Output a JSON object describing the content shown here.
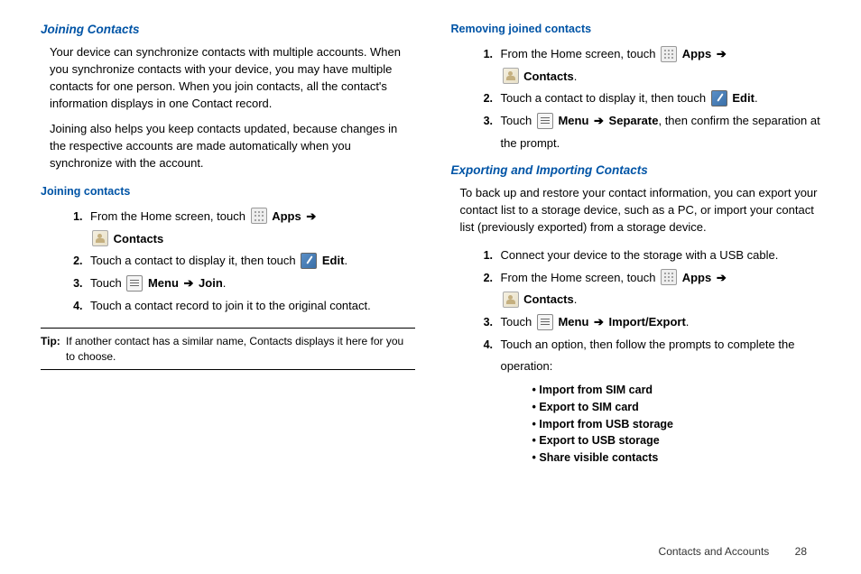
{
  "leftColumn": {
    "joiningContacts": {
      "heading": "Joining Contacts",
      "para1": "Your device can synchronize contacts with multiple accounts. When you synchronize contacts with your device, you may have multiple contacts for one person. When you join contacts, all the contact's information displays in one Contact record.",
      "para2": "Joining also helps you keep contacts updated, because changes in the respective accounts are made automatically when you synchronize with the account."
    },
    "joiningContactsSteps": {
      "heading": "Joining contacts",
      "step1_prefix": "From the Home screen, touch ",
      "step1_apps": "Apps",
      "step1_contacts": "Contacts",
      "step2_prefix": "Touch a contact to display it, then touch ",
      "step2_edit": "Edit",
      "step3_prefix": "Touch ",
      "step3_menu": "Menu",
      "step3_join": "Join",
      "step4": "Touch a contact record to join it to the original contact."
    },
    "tip": {
      "label": "Tip:",
      "text": "If another contact has a similar name, Contacts displays it here for you to choose."
    }
  },
  "rightColumn": {
    "removingJoined": {
      "heading": "Removing joined contacts",
      "step1_prefix": "From the Home screen, touch ",
      "step1_apps": "Apps",
      "step1_contacts": "Contacts",
      "step2_prefix": "Touch a contact to display it, then touch ",
      "step2_edit": "Edit",
      "step3_prefix": "Touch ",
      "step3_menu": "Menu",
      "step3_separate": "Separate",
      "step3_suffix": ", then confirm the separation at the prompt."
    },
    "exportImport": {
      "heading": "Exporting and Importing Contacts",
      "para": "To back up and restore your contact information, you can export your contact list to a storage device, such as a PC, or import your contact list (previously exported) from a storage device.",
      "step1": "Connect your device to the storage with a USB cable.",
      "step2_prefix": "From the Home screen, touch ",
      "step2_apps": "Apps",
      "step2_contacts": "Contacts",
      "step3_prefix": "Touch ",
      "step3_menu": "Menu",
      "step3_importexport": "Import/Export",
      "step4": "Touch an option, then follow the prompts to complete the operation:",
      "bullets": {
        "b1": "Import from SIM card",
        "b2": "Export to SIM card",
        "b3": "Import from USB storage",
        "b4": "Export to USB storage",
        "b5": "Share visible contacts"
      }
    }
  },
  "footer": {
    "section": "Contacts and Accounts",
    "page": "28"
  },
  "arrow": "➔"
}
